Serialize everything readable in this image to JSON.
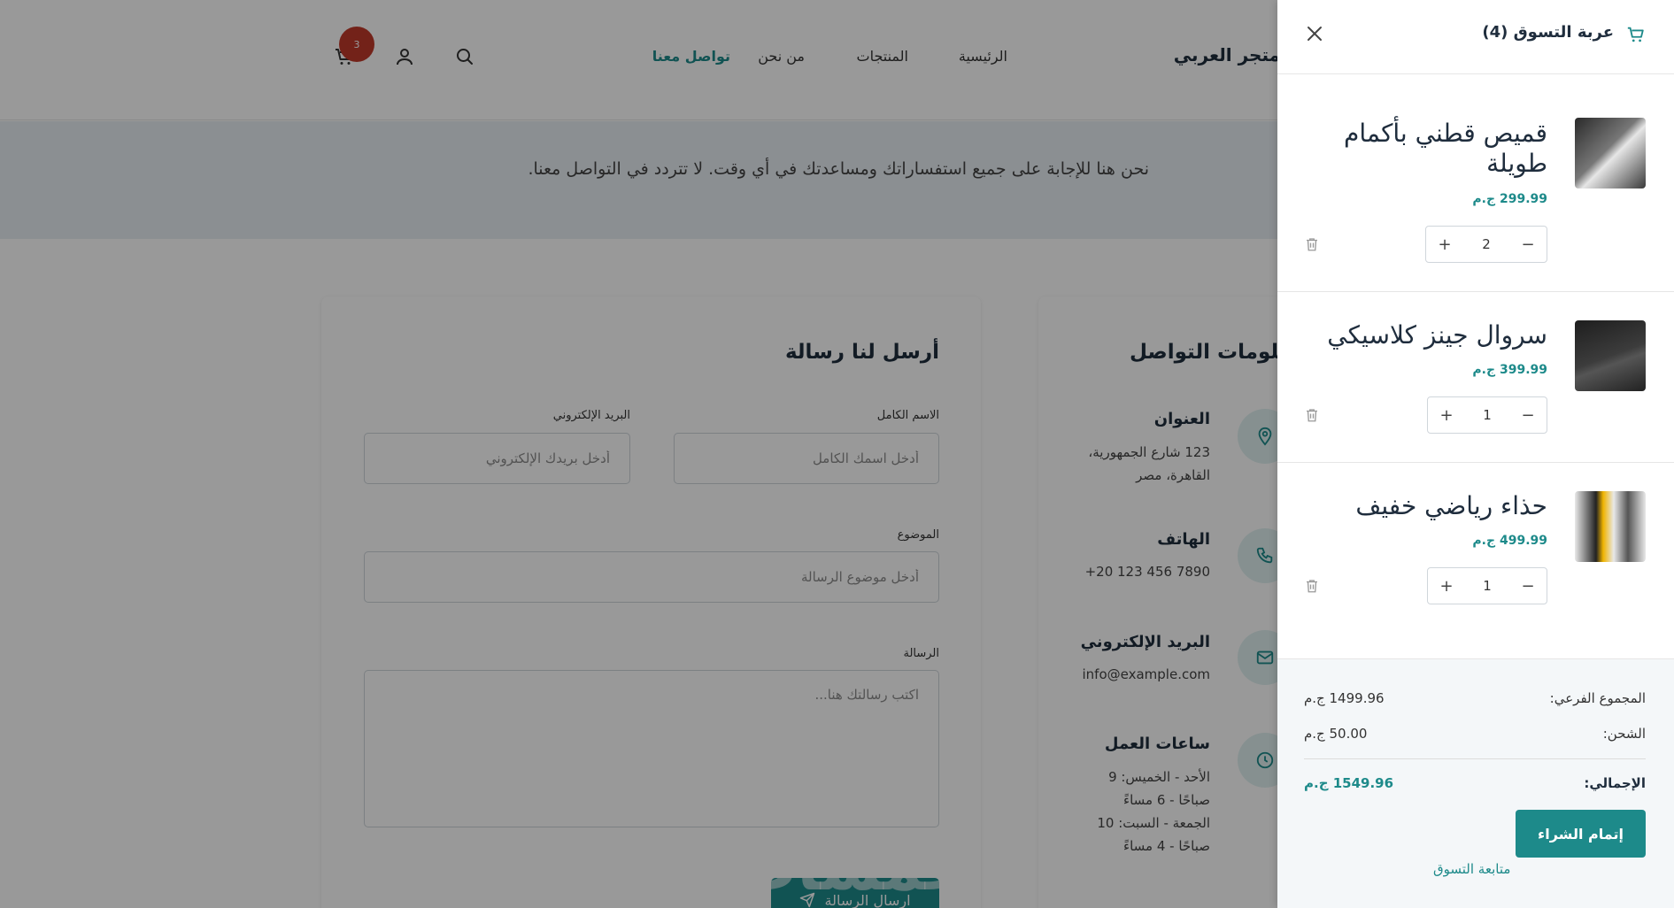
{
  "header": {
    "brand": "متجر العربي",
    "nav": [
      "الرئيسية",
      "المنتجات",
      "من نحن",
      "تواصل معنا"
    ],
    "active_nav": "تواصل معنا",
    "cart_count": "3"
  },
  "hero": {
    "subtitle": "نحن هنا للإجابة على جميع استفساراتك ومساعدتك في أي وقت. لا تتردد في التواصل معنا."
  },
  "contact_form": {
    "title": "أرسل لنا رسالة",
    "fullname_label": "الاسم الكامل",
    "fullname_placeholder": "أدخل اسمك الكامل",
    "email_label": "البريد الإلكتروني",
    "email_placeholder": "أدخل بريدك الإلكتروني",
    "subject_label": "الموضوع",
    "subject_placeholder": "أدخل موضوع الرسالة",
    "message_label": "الرسالة",
    "message_placeholder": "اكتب رسالتك هنا...",
    "send_label": "ارسال الرسالة"
  },
  "contact_info": {
    "title": "معلومات التواصل",
    "address_title": "العنوان",
    "address_line1": "123 شارع الجمهورية،",
    "address_line2": "القاهرة، مصر",
    "phone_title": "الهاتف",
    "phone_value": "+20 123 456 7890",
    "email_title": "البريد الإلكتروني",
    "email_value": "info@example.com",
    "hours_title": "ساعات العمل",
    "hours_line1": "الأحد - الخميس: 9",
    "hours_line2": "صباحًا - 6 مساءً",
    "hours_line3": "الجمعة - السبت: 10",
    "hours_line4": "صباحًا - 4 مساءً"
  },
  "watermark": "خمسات",
  "cart": {
    "title": "عربة التسوق (4)",
    "items": [
      {
        "name": "قميص قطني بأكمام طويلة",
        "price": "299.99 ج.م",
        "qty": "2"
      },
      {
        "name": "سروال جينز كلاسيكي",
        "price": "399.99 ج.م",
        "qty": "1"
      },
      {
        "name": "حذاء رياضي خفيف",
        "price": "499.99 ج.م",
        "qty": "1"
      }
    ],
    "subtotal_label": "المجموع الفرعي:",
    "subtotal_value": "1499.96 ج.م",
    "shipping_label": "الشحن:",
    "shipping_value": "50.00 ج.م",
    "total_label": "الإجمالي:",
    "total_value": "1549.96 ج.م",
    "checkout_label": "إتمام الشراء",
    "continue_label": "متابعة التسوق"
  },
  "colors": {
    "accent": "#1d8a8a",
    "badge": "#c0392b",
    "overlay": "rgba(0,0,0,0.4)"
  }
}
